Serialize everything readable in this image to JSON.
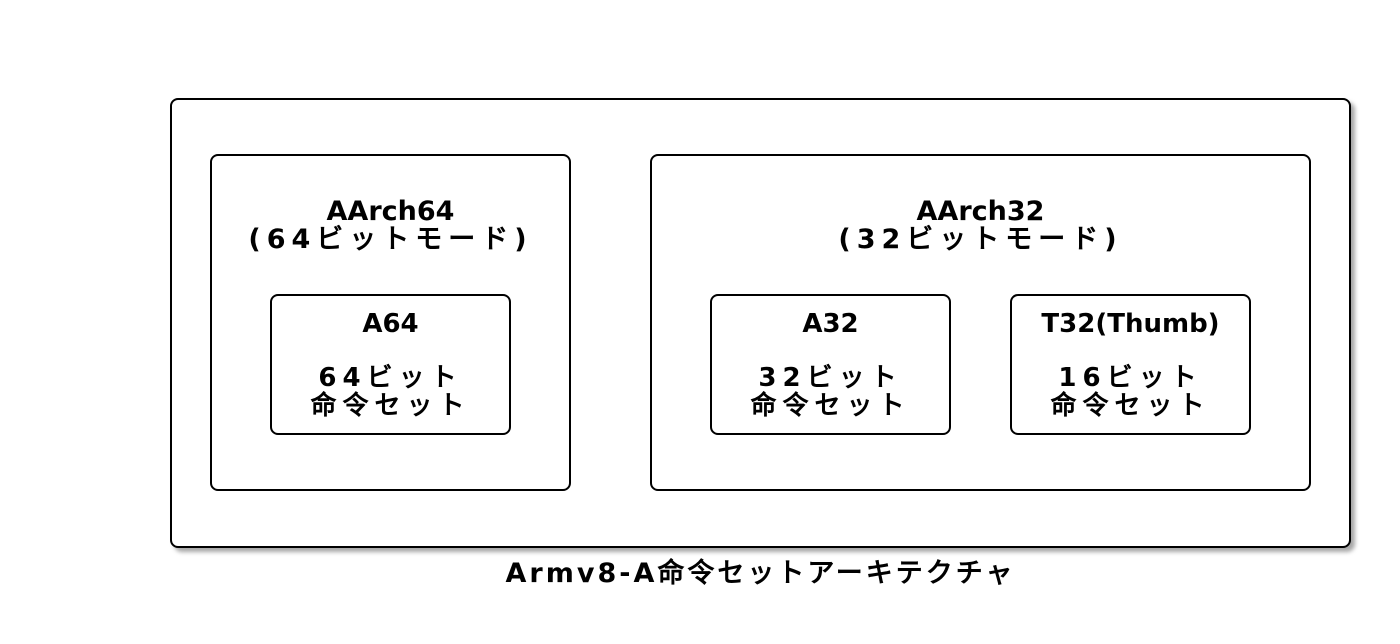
{
  "outer": {
    "caption": "Armv8-A命令セットアーキテクチャ"
  },
  "aarch64": {
    "title": "AArch64",
    "subtitle": "(64ビットモード)",
    "isas": [
      {
        "name": "A64",
        "desc_line1": "64ビット",
        "desc_line2": "命令セット"
      }
    ]
  },
  "aarch32": {
    "title": "AArch32",
    "subtitle": "(32ビットモード)",
    "isas": [
      {
        "name": "A32",
        "desc_line1": "32ビット",
        "desc_line2": "命令セット"
      },
      {
        "name": "T32(Thumb)",
        "desc_line1": "16ビット",
        "desc_line2": "命令セット"
      }
    ]
  },
  "colors": {
    "stroke": "#000000",
    "background": "#ffffff"
  }
}
